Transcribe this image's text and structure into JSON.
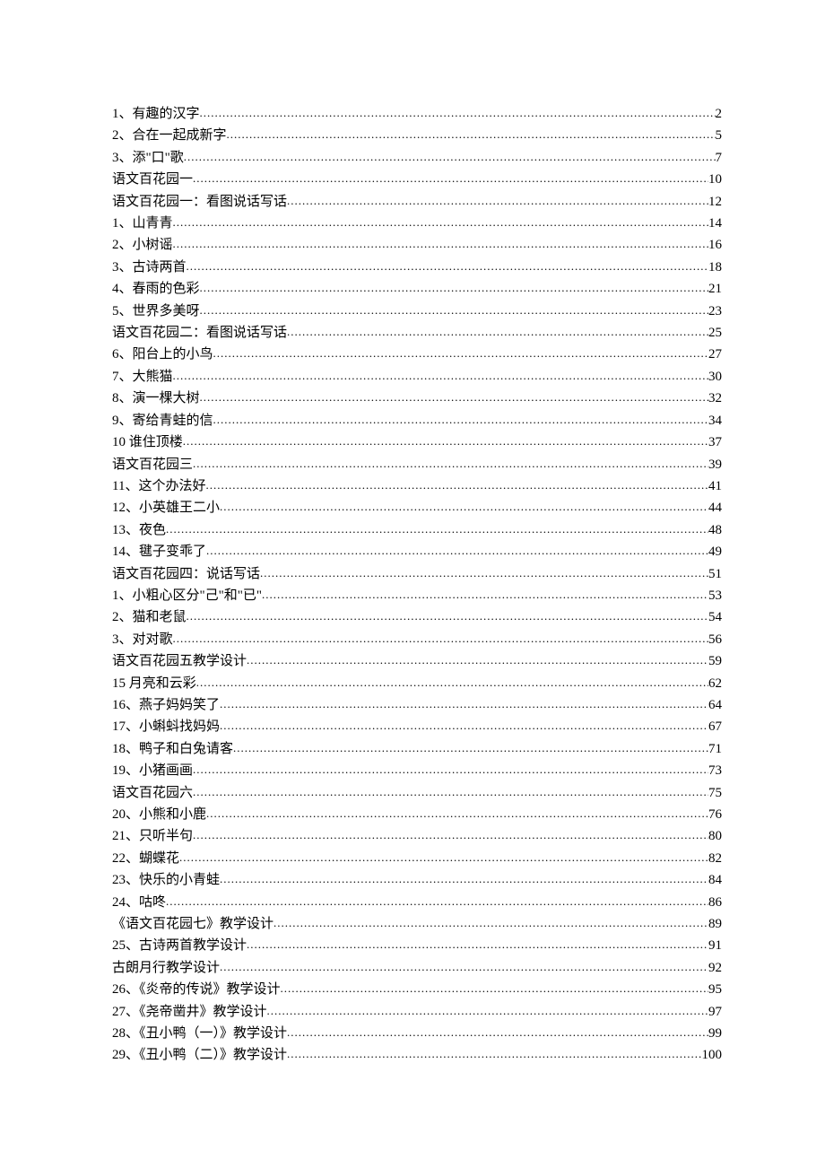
{
  "toc": [
    {
      "title": "1、有趣的汉字",
      "page": "2"
    },
    {
      "title": "2、合在一起成新字",
      "page": "5"
    },
    {
      "title": "3、添\"口\"歌",
      "page": "7"
    },
    {
      "title": "语文百花园一",
      "page": "10"
    },
    {
      "title": "语文百花园一：看图说话写话",
      "page": "12"
    },
    {
      "title": "1、山青青",
      "page": "14"
    },
    {
      "title": "2、小树谣",
      "page": "16"
    },
    {
      "title": "3、古诗两首",
      "page": "18"
    },
    {
      "title": "4、春雨的色彩",
      "page": "21"
    },
    {
      "title": "5、世界多美呀",
      "page": "23"
    },
    {
      "title": "语文百花园二：看图说话写话",
      "page": "25"
    },
    {
      "title": "6、阳台上的小鸟",
      "page": "27"
    },
    {
      "title": "7、大熊猫",
      "page": "30"
    },
    {
      "title": "8、演一棵大树",
      "page": "32"
    },
    {
      "title": "9、寄给青蛙的信",
      "page": "34"
    },
    {
      "title": "10 谁住顶楼",
      "page": "37"
    },
    {
      "title": "语文百花园三",
      "page": "39"
    },
    {
      "title": "11、这个办法好",
      "page": "41"
    },
    {
      "title": "12、小英雄王二小",
      "page": "44"
    },
    {
      "title": "13、夜色",
      "page": "48"
    },
    {
      "title": "14、毽子变乖了",
      "page": "49"
    },
    {
      "title": "语文百花园四：说话写话",
      "page": "51"
    },
    {
      "title": "1、小粗心区分\"己\"和\"已\"",
      "page": "53"
    },
    {
      "title": "2、猫和老鼠",
      "page": "54"
    },
    {
      "title": "3、对对歌",
      "page": "56"
    },
    {
      "title": "语文百花园五教学设计",
      "page": "59"
    },
    {
      "title": "15 月亮和云彩",
      "page": "62"
    },
    {
      "title": "16、燕子妈妈笑了",
      "page": "64"
    },
    {
      "title": "17、小蝌蚪找妈妈",
      "page": "67"
    },
    {
      "title": "18、鸭子和白兔请客",
      "page": "71"
    },
    {
      "title": "19、小猪画画",
      "page": "73"
    },
    {
      "title": "语文百花园六",
      "page": "75"
    },
    {
      "title": "20、小熊和小鹿",
      "page": "76"
    },
    {
      "title": "21、只听半句",
      "page": "80"
    },
    {
      "title": "22、蝴蝶花",
      "page": "82"
    },
    {
      "title": "23、快乐的小青蛙",
      "page": "84"
    },
    {
      "title": "24、咕咚",
      "page": "86"
    },
    {
      "title": "《语文百花园七》教学设计",
      "page": "89"
    },
    {
      "title": "25、古诗两首教学设计",
      "page": "91"
    },
    {
      "title": "古朗月行教学设计",
      "page": "92"
    },
    {
      "title": "26、《炎帝的传说》教学设计",
      "page": "95"
    },
    {
      "title": "27、《尧帝凿井》教学设计",
      "page": "97"
    },
    {
      "title": "28、《丑小鸭（一）》教学设计",
      "page": "99"
    },
    {
      "title": "29、《丑小鸭（二）》教学设计",
      "page": "100"
    }
  ]
}
